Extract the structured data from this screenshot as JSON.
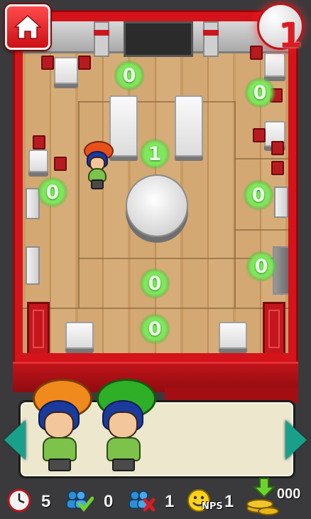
{
  "hud": {
    "home_icon": "home-icon",
    "level": "1"
  },
  "zones": [
    {
      "id": "top-center",
      "count": "0"
    },
    {
      "id": "top-right",
      "count": "0"
    },
    {
      "id": "center",
      "count": "1"
    },
    {
      "id": "left",
      "count": "0"
    },
    {
      "id": "right",
      "count": "0"
    },
    {
      "id": "right-lower",
      "count": "0"
    },
    {
      "id": "bottom-center",
      "count": "0"
    },
    {
      "id": "entrance",
      "count": "0"
    }
  ],
  "room_guest": {
    "hat_color": "#e8501a"
  },
  "queue": {
    "guests": [
      {
        "hat_color": "#f08a1c"
      },
      {
        "hat_color": "#2fae28"
      }
    ]
  },
  "status": {
    "timer": {
      "icon": "clock-icon",
      "value": "5"
    },
    "served": {
      "icon": "people-check-icon",
      "value": "0"
    },
    "lost": {
      "icon": "people-x-icon",
      "value": "1"
    },
    "nps": {
      "icon": "smiley-nps-icon",
      "label": "NPS",
      "value": "1"
    },
    "coins": {
      "icon": "coins-arrow-icon",
      "value": "000"
    }
  },
  "colors": {
    "accent": "#d4141a",
    "zone_green": "#5ccf3c",
    "arrow": "#19a08a"
  }
}
